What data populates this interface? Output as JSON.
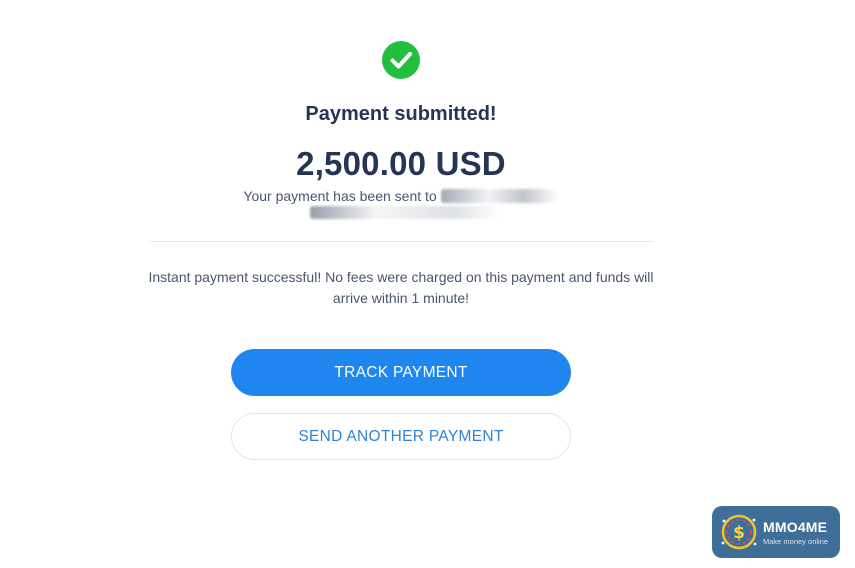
{
  "status": {
    "title": "Payment submitted!",
    "amount": "2,500.00 USD",
    "sent_prefix": "Your payment has been sent to",
    "info": "Instant payment successful! No fees were charged on this payment and funds will arrive within 1 minute!"
  },
  "actions": {
    "track_label": "TRACK PAYMENT",
    "send_another_label": "SEND ANOTHER PAYMENT"
  },
  "watermark": {
    "brand": "MMO4ME",
    "tagline": "Make money online"
  },
  "icons": {
    "status": "check-circle-icon",
    "watermark": "dollar-coin-icon"
  },
  "colors": {
    "success": "#22bf3f",
    "primary_button": "#1f86f0",
    "heading": "#273554",
    "watermark_bg": "#3f6f99"
  }
}
